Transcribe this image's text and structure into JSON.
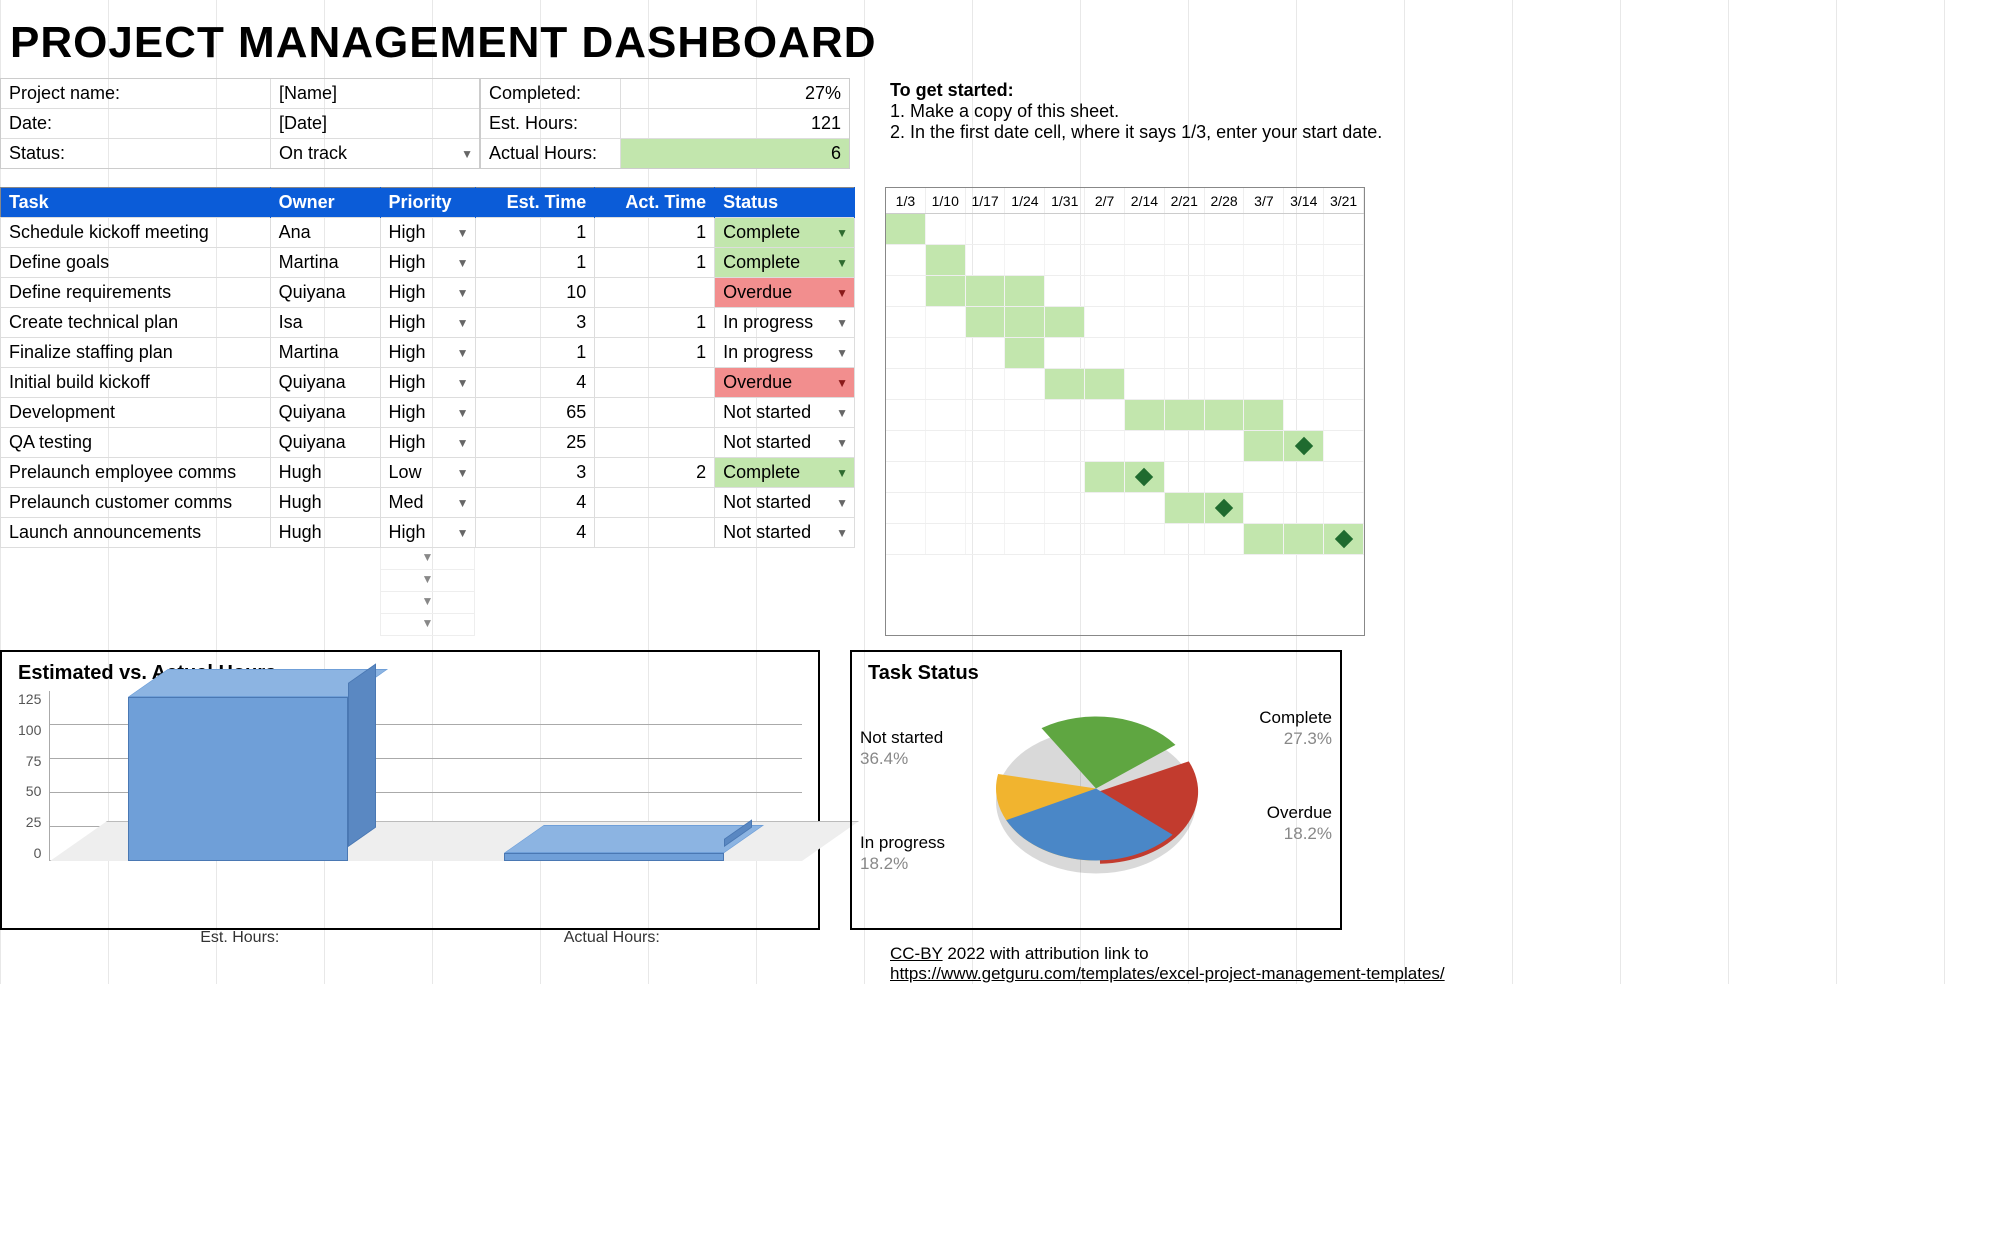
{
  "title": "PROJECT MANAGEMENT DASHBOARD",
  "info": {
    "project_name_label": "Project name:",
    "project_name_value": "[Name]",
    "date_label": "Date:",
    "date_value": "[Date]",
    "status_label": "Status:",
    "status_value": "On track"
  },
  "metrics": {
    "completed_label": "Completed:",
    "completed_value": "27%",
    "est_hours_label": "Est. Hours:",
    "est_hours_value": "121",
    "actual_hours_label": "Actual Hours:",
    "actual_hours_value": "6"
  },
  "help": {
    "title": "To get started:",
    "line1": "1. Make a copy of this sheet.",
    "line2": "2. In the first date cell, where it says 1/3, enter your start date."
  },
  "task_headers": {
    "task": "Task",
    "owner": "Owner",
    "priority": "Priority",
    "est_time": "Est. Time",
    "act_time": "Act. Time",
    "status": "Status"
  },
  "tasks": [
    {
      "task": "Schedule kickoff meeting",
      "owner": "Ana",
      "priority": "High",
      "est": "1",
      "act": "1",
      "status": "Complete",
      "status_class": "complete",
      "gstart": 0,
      "gend": 0
    },
    {
      "task": "Define goals",
      "owner": "Martina",
      "priority": "High",
      "est": "1",
      "act": "1",
      "status": "Complete",
      "status_class": "complete",
      "gstart": 1,
      "gend": 1
    },
    {
      "task": "Define requirements",
      "owner": "Quiyana",
      "priority": "High",
      "est": "10",
      "act": "",
      "status": "Overdue",
      "status_class": "overdue",
      "gstart": 1,
      "gend": 3
    },
    {
      "task": "Create technical plan",
      "owner": "Isa",
      "priority": "High",
      "est": "3",
      "act": "1",
      "status": "In progress",
      "status_class": "plain",
      "gstart": 2,
      "gend": 4
    },
    {
      "task": "Finalize staffing plan",
      "owner": "Martina",
      "priority": "High",
      "est": "1",
      "act": "1",
      "status": "In progress",
      "status_class": "plain",
      "gstart": 3,
      "gend": 3
    },
    {
      "task": "Initial build kickoff",
      "owner": "Quiyana",
      "priority": "High",
      "est": "4",
      "act": "",
      "status": "Overdue",
      "status_class": "overdue",
      "gstart": 4,
      "gend": 5
    },
    {
      "task": "Development",
      "owner": "Quiyana",
      "priority": "High",
      "est": "65",
      "act": "",
      "status": "Not started",
      "status_class": "plain",
      "gstart": 6,
      "gend": 9
    },
    {
      "task": "QA testing",
      "owner": "Quiyana",
      "priority": "High",
      "est": "25",
      "act": "",
      "status": "Not started",
      "status_class": "plain",
      "gstart": 9,
      "gend": 10,
      "diamond": 10
    },
    {
      "task": "Prelaunch employee comms",
      "owner": "Hugh",
      "priority": "Low",
      "est": "3",
      "act": "2",
      "status": "Complete",
      "status_class": "complete",
      "gstart": 5,
      "gend": 6,
      "diamond": 6
    },
    {
      "task": "Prelaunch customer comms",
      "owner": "Hugh",
      "priority": "Med",
      "est": "4",
      "act": "",
      "status": "Not started",
      "status_class": "plain",
      "gstart": 7,
      "gend": 8,
      "diamond": 8
    },
    {
      "task": "Launch announcements",
      "owner": "Hugh",
      "priority": "High",
      "est": "4",
      "act": "",
      "status": "Not started",
      "status_class": "plain",
      "gstart": 9,
      "gend": 11,
      "diamond": 11
    }
  ],
  "gantt_dates": [
    "1/3",
    "1/10",
    "1/17",
    "1/24",
    "1/31",
    "2/7",
    "2/14",
    "2/21",
    "2/28",
    "3/7",
    "3/14",
    "3/21"
  ],
  "bar_chart": {
    "title": "Estimated vs. Actual Hours",
    "yticks": [
      "125",
      "100",
      "75",
      "50",
      "25",
      "0"
    ],
    "cat1": "Est. Hours:",
    "cat2": "Actual Hours:"
  },
  "pie_chart": {
    "title": "Task Status",
    "labels": {
      "complete": "Complete",
      "complete_pct": "27.3%",
      "overdue": "Overdue",
      "overdue_pct": "18.2%",
      "inprogress": "In progress",
      "inprogress_pct": "18.2%",
      "notstarted": "Not started",
      "notstarted_pct": "36.4%"
    }
  },
  "footer": {
    "line1_pre": "CC-BY",
    "line1_rest": " 2022 with attribution link to",
    "line2": "https://www.getguru.com/templates/excel-project-management-templates/"
  },
  "chart_data": [
    {
      "type": "bar",
      "title": "Estimated vs. Actual Hours",
      "categories": [
        "Est. Hours:",
        "Actual Hours:"
      ],
      "values": [
        121,
        6
      ],
      "ylim": [
        0,
        125
      ],
      "ylabel": "",
      "xlabel": ""
    },
    {
      "type": "pie",
      "title": "Task Status",
      "series": [
        {
          "name": "Complete",
          "value": 27.3
        },
        {
          "name": "Overdue",
          "value": 18.2
        },
        {
          "name": "In progress",
          "value": 18.2
        },
        {
          "name": "Not started",
          "value": 36.4
        }
      ]
    }
  ]
}
